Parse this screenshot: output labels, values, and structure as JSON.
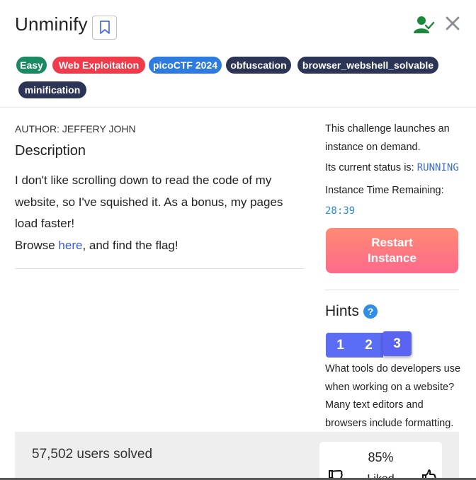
{
  "challenge": {
    "title": "Unminify"
  },
  "tags": [
    {
      "label": "Easy",
      "color": "#1a8a63"
    },
    {
      "label": "Web Exploitation",
      "color": "#ef3b4a"
    },
    {
      "label": "picoCTF 2024",
      "color": "#2e7be0"
    },
    {
      "label": "obfuscation",
      "color": "#2c3556"
    },
    {
      "label": "browser_webshell_solvable",
      "color": "#2c3556"
    },
    {
      "label": "minification",
      "color": "#2c3556"
    }
  ],
  "description": {
    "author": "AUTHOR: JEFFERY JOHN",
    "heading": "Description",
    "text": "I don't like scrolling down to read the code of my website, so I've squished it. As a bonus, my pages load faster!",
    "browse_prefix": "Browse ",
    "browse_link": "here",
    "browse_suffix": ", and find the flag!"
  },
  "instance": {
    "line1": "This challenge launches an",
    "line2": "instance on demand.",
    "status_label": "Its current status is: ",
    "status_value": "RUNNING",
    "time_label": "Instance Time Remaining:",
    "time_value": "28:39",
    "restart_line1": "Restart",
    "restart_line2": "Instance"
  },
  "hints": {
    "title": "Hints",
    "help_glyph": "?",
    "buttons": [
      "1",
      "2",
      "3"
    ],
    "active": "3",
    "text": "What tools do developers use when working on a website? Many text editors and browsers include formatting."
  },
  "footer": {
    "solved": "57,502 users solved",
    "rating": "85%",
    "rating_label": "Liked"
  },
  "icons": {
    "bookmark": "bookmark-icon",
    "user_check": "user-check-icon",
    "close": "close-icon",
    "help": "help-icon",
    "thumbs_down": "thumbs-down-icon",
    "thumbs_up": "thumbs-up-icon"
  },
  "colors": {
    "accent_blue": "#5b6cf5",
    "restart_gradient_top": "#ff8a73",
    "restart_gradient_bottom": "#ff6a8b",
    "success_green": "#1a8a3a"
  }
}
